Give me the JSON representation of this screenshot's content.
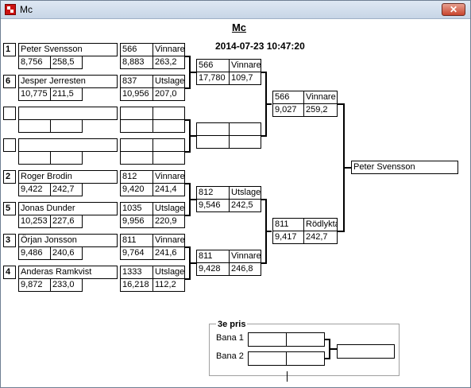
{
  "window": {
    "title": "Mc"
  },
  "header": {
    "title": "Mc",
    "datetime": "2014-07-23 10:47:20"
  },
  "round1": [
    {
      "seed": "1",
      "name": "Peter Svensson",
      "v1": "8,756",
      "v2": "258,5",
      "num": "566",
      "status": "Vinnare",
      "t1": "8,883",
      "t2": "263,2"
    },
    {
      "seed": "6",
      "name": "Jesper Jerresten",
      "v1": "10,775",
      "v2": "211,5",
      "num": "837",
      "status": "Utslagen",
      "t1": "10,956",
      "t2": "207,0"
    },
    {
      "seed": "",
      "name": "",
      "v1": "",
      "v2": "",
      "num": "",
      "status": "",
      "t1": "",
      "t2": ""
    },
    {
      "seed": "",
      "name": "",
      "v1": "",
      "v2": "",
      "num": "",
      "status": "",
      "t1": "",
      "t2": ""
    },
    {
      "seed": "2",
      "name": "Roger Brodin",
      "v1": "9,422",
      "v2": "242,7",
      "num": "812",
      "status": "Vinnare",
      "t1": "9,420",
      "t2": "241,4"
    },
    {
      "seed": "5",
      "name": "Jonas Dunder",
      "v1": "10,253",
      "v2": "227,6",
      "num": "1035",
      "status": "Utslagen",
      "t1": "9,956",
      "t2": "220,9"
    },
    {
      "seed": "3",
      "name": "Örjan Jonsson",
      "v1": "9,486",
      "v2": "240,6",
      "num": "811",
      "status": "Vinnare",
      "t1": "9,764",
      "t2": "241,6"
    },
    {
      "seed": "4",
      "name": "Anderas Ramkvist",
      "v1": "9,872",
      "v2": "233,0",
      "num": "1333",
      "status": "Utslagen",
      "t1": "16,218",
      "t2": "112,2"
    }
  ],
  "round2": [
    {
      "num": "566",
      "status": "Vinnare",
      "t1": "17,780",
      "t2": "109,7"
    },
    {
      "num": "",
      "status": "",
      "t1": "",
      "t2": ""
    },
    {
      "num": "812",
      "status": "Utslagen",
      "t1": "9,546",
      "t2": "242,5"
    },
    {
      "num": "811",
      "status": "Vinnare",
      "t1": "9,428",
      "t2": "246,8"
    }
  ],
  "round3": [
    {
      "num": "566",
      "status": "Vinnare",
      "t1": "9,027",
      "t2": "259,2"
    },
    {
      "num": "811",
      "status": "Rödlykta",
      "t1": "9,417",
      "t2": "242,7"
    }
  ],
  "final": {
    "winner": "Peter Svensson"
  },
  "third_place": {
    "title": "3e pris",
    "lane1": "Bana 1",
    "lane2": "Bana 2"
  }
}
